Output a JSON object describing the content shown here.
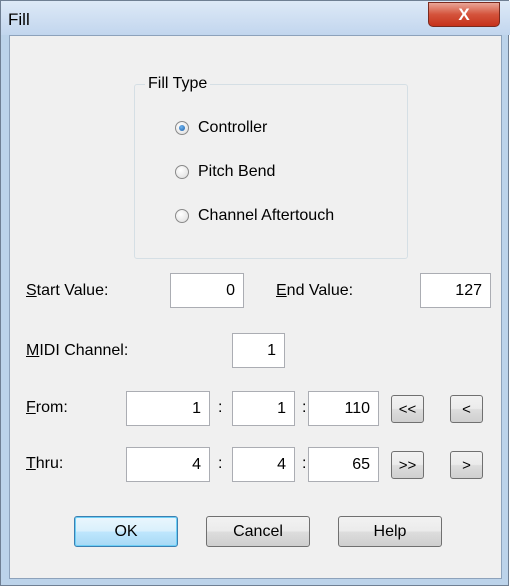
{
  "window": {
    "title": "Fill",
    "close_glyph": "X"
  },
  "fill_type": {
    "group_label": "Fill Type",
    "options": [
      {
        "label": "Controller",
        "checked": true
      },
      {
        "label": "Pitch Bend",
        "checked": false
      },
      {
        "label": "Channel Aftertouch",
        "checked": false
      }
    ]
  },
  "start_value": {
    "label_key": "S",
    "label_rest": "tart Value:",
    "value": "0"
  },
  "end_value": {
    "label_key": "E",
    "label_rest": "nd Value:",
    "value": "127"
  },
  "midi_channel": {
    "label_key": "M",
    "label_rest": "IDI Channel:",
    "value": "1"
  },
  "from": {
    "label_key": "F",
    "label_rest": "rom:",
    "bar": "1",
    "beat": "1",
    "tick": "110",
    "sep": ":",
    "rewind_label": "<<",
    "back_label": "<"
  },
  "thru": {
    "label_key": "T",
    "label_rest": "hru:",
    "bar": "4",
    "beat": "4",
    "tick": "65",
    "sep": ":",
    "fast_forward_label": ">>",
    "forward_label": ">"
  },
  "buttons": {
    "ok": "OK",
    "cancel": "Cancel",
    "help": "Help"
  },
  "colors": {
    "title_bar": "#c2d6ee",
    "close_button": "#c6321b",
    "dialog_bg": "#f0f0f0",
    "default_button_border": "#3c7fb1"
  }
}
